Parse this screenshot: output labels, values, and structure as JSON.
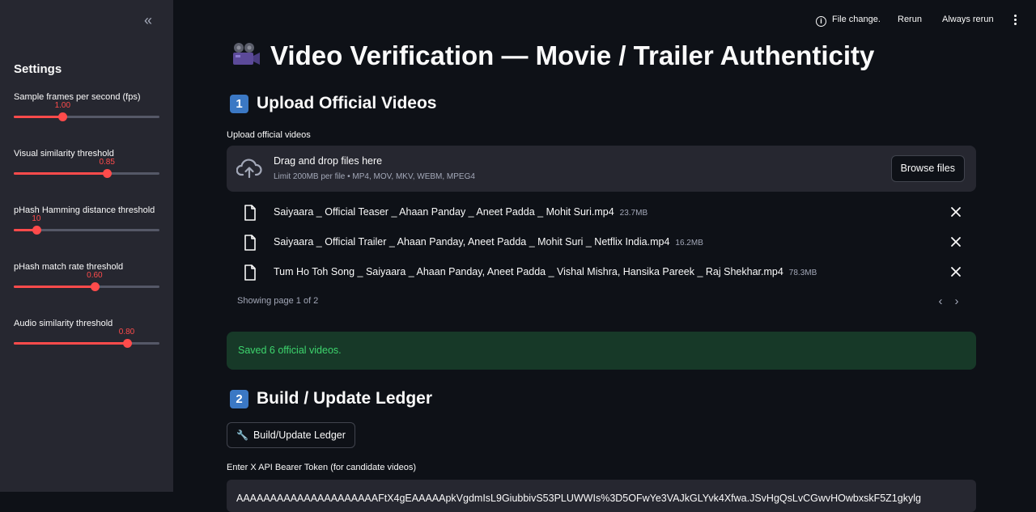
{
  "sidebar": {
    "title": "Settings",
    "sliders": [
      {
        "label": "Sample frames per second (fps)",
        "value": "1.00",
        "fraction": 0.335
      },
      {
        "label": "Visual similarity threshold",
        "value": "0.85",
        "fraction": 0.64
      },
      {
        "label": "pHash Hamming distance threshold",
        "value": "10",
        "fraction": 0.155
      },
      {
        "label": "pHash match rate threshold",
        "value": "0.60",
        "fraction": 0.555
      },
      {
        "label": "Audio similarity threshold",
        "value": "0.80",
        "fraction": 0.775
      }
    ]
  },
  "topbar": {
    "file_change": "File change.",
    "rerun": "Rerun",
    "always_rerun": "Always rerun"
  },
  "main": {
    "title": "Video Verification — Movie / Trailer Authenticity",
    "section1": {
      "badge": "1",
      "title": "Upload Official Videos",
      "upload_label": "Upload official videos",
      "dropzone_main": "Drag and drop files here",
      "dropzone_sub": "Limit 200MB per file • MP4, MOV, MKV, WEBM, MPEG4",
      "browse_label": "Browse files",
      "files": [
        {
          "name": "Saiyaara _ Official Teaser _ Ahaan Panday _ Aneet Padda _ Mohit Suri.mp4",
          "size": "23.7MB"
        },
        {
          "name": "Saiyaara _ Official Trailer _ Ahaan Panday, Aneet Padda _ Mohit Suri _ Netflix India.mp4",
          "size": "16.2MB"
        },
        {
          "name": "Tum Ho Toh Song _ Saiyaara _ Ahaan Panday, Aneet Padda _ Vishal Mishra, Hansika Pareek _ Raj Shekhar.mp4",
          "size": "78.3MB"
        }
      ],
      "pager_text": "Showing page 1 of 2",
      "success": "Saved 6 official videos."
    },
    "section2": {
      "badge": "2",
      "title": "Build / Update Ledger",
      "build_label": "Build/Update Ledger",
      "token_label": "Enter X API Bearer Token (for candidate videos)",
      "token_value": "AAAAAAAAAAAAAAAAAAAAAFtX4gEAAAAApkVgdmIsL9GiubbivS53PLUWWIs%3D5OFwYe3VAJkGLYvk4Xfwa.JSvHgQsLvCGwvHOwbxskF5Z1gkylg"
    }
  },
  "colors": {
    "accent": "#ff4b4b",
    "background": "#0e1117",
    "sidebar": "#262730",
    "success_bg": "#173928",
    "success_text": "#3dd56d"
  }
}
